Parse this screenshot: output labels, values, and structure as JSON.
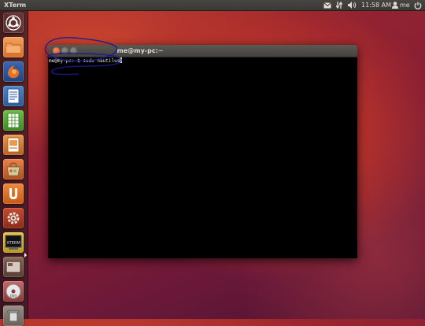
{
  "top_panel": {
    "app_title": "XTerm",
    "clock": "11:58 AM",
    "username": "me",
    "icons": [
      "mail-icon",
      "network-icon",
      "volume-icon",
      "battery-icon",
      "user-icon",
      "power-icon"
    ]
  },
  "launcher": {
    "items": [
      {
        "name": "dash-home",
        "icon": "ubuntu-logo-icon"
      },
      {
        "name": "home-folder",
        "icon": "folder-icon"
      },
      {
        "name": "firefox",
        "icon": "firefox-icon"
      },
      {
        "name": "libreoffice-writer",
        "icon": "writer-icon"
      },
      {
        "name": "libreoffice-calc",
        "icon": "calc-icon"
      },
      {
        "name": "libreoffice-impress",
        "icon": "impress-icon"
      },
      {
        "name": "ubuntu-software-center",
        "icon": "software-center-icon"
      },
      {
        "name": "ubuntu-one",
        "icon": "ubuntu-one-icon"
      },
      {
        "name": "system-settings",
        "icon": "settings-icon"
      },
      {
        "name": "xterm",
        "icon": "xterm-icon",
        "label": "XTERM",
        "active": true
      },
      {
        "name": "workspace-switcher",
        "icon": "workspace-icon"
      },
      {
        "name": "dvd",
        "icon": "dvd-icon",
        "label": "DVD"
      },
      {
        "name": "trash",
        "icon": "trash-icon"
      }
    ]
  },
  "window": {
    "title": "me@my-pc:~",
    "prompt": "me@my-pc:~$ ",
    "command": "sudo nautilus"
  },
  "colors": {
    "terminal_bg": "#000000",
    "close_button": "#e05a2a",
    "annotation_ink": "#1a1a8c"
  }
}
